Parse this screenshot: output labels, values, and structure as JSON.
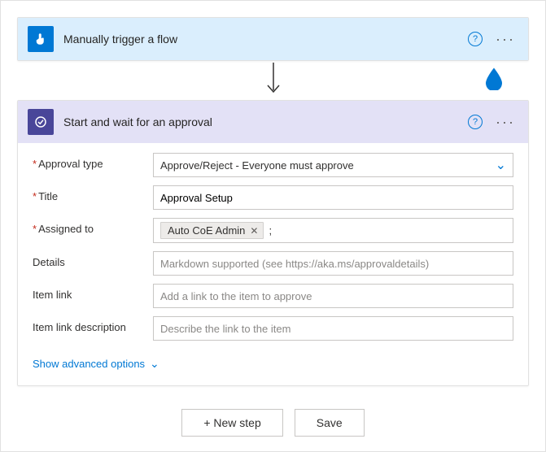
{
  "trigger": {
    "title": "Manually trigger a flow",
    "icon": "hand-pointer-icon"
  },
  "action": {
    "title": "Start and wait for an approval",
    "icon": "approval-check-icon",
    "fields": {
      "approval_type": {
        "label": "Approval type",
        "required": true,
        "value": "Approve/Reject - Everyone must approve"
      },
      "title": {
        "label": "Title",
        "required": true,
        "value": "Approval Setup"
      },
      "assigned_to": {
        "label": "Assigned to",
        "required": true,
        "chip": "Auto CoE Admin",
        "separator": ";"
      },
      "details": {
        "label": "Details",
        "placeholder": "Markdown supported (see https://aka.ms/approvaldetails)"
      },
      "item_link": {
        "label": "Item link",
        "placeholder": "Add a link to the item to approve"
      },
      "item_link_desc": {
        "label": "Item link description",
        "placeholder": "Describe the link to the item"
      }
    },
    "show_advanced": "Show advanced options"
  },
  "footer": {
    "new_step": "+ New step",
    "save": "Save"
  }
}
